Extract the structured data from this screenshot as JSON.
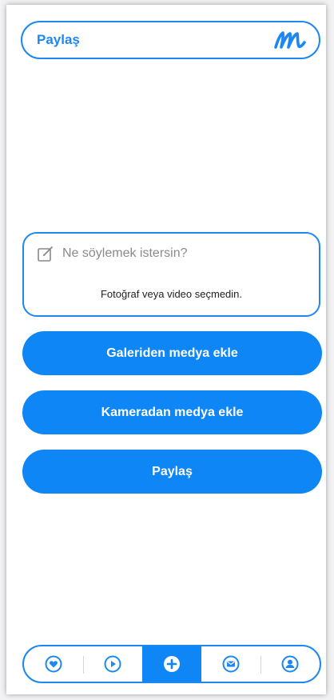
{
  "header": {
    "title": "Paylaş",
    "logo_icon": "brand-m-logo"
  },
  "composer": {
    "placeholder": "Ne söylemek istersin?",
    "media_hint": "Fotoğraf veya video seçmedin.",
    "icon": "edit-icon"
  },
  "actions": {
    "gallery_label": "Galeriden medya ekle",
    "camera_label": "Kameradan medya ekle",
    "share_label": "Paylaş"
  },
  "bottom_nav": {
    "items": [
      {
        "icon": "heart-icon",
        "active": false
      },
      {
        "icon": "play-icon",
        "active": false
      },
      {
        "icon": "plus-icon",
        "active": true
      },
      {
        "icon": "mail-icon",
        "active": false
      },
      {
        "icon": "profile-icon",
        "active": false
      }
    ]
  },
  "colors": {
    "accent": "#0f86f5",
    "border": "#1e88f2",
    "background": "#ffffff"
  }
}
